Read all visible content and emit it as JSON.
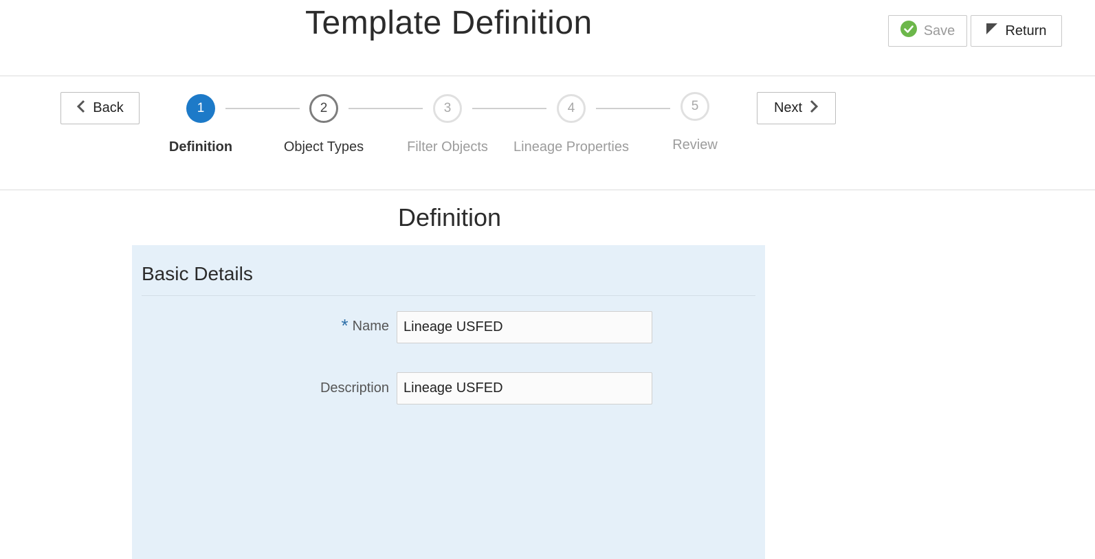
{
  "header": {
    "title": "Template Definition",
    "save_label": "Save",
    "return_label": "Return"
  },
  "train": {
    "back_label": "Back",
    "next_label": "Next",
    "steps": [
      {
        "number": "1",
        "label": "Definition",
        "state": "active"
      },
      {
        "number": "2",
        "label": "Object Types",
        "state": "visited"
      },
      {
        "number": "3",
        "label": "Filter Objects",
        "state": "disabled"
      },
      {
        "number": "4",
        "label": "Lineage Properties",
        "state": "disabled"
      },
      {
        "number": "5",
        "label": "Review",
        "state": "disabled"
      }
    ]
  },
  "main": {
    "section_title": "Definition",
    "panel_title": "Basic Details",
    "fields": {
      "name": {
        "label": "Name",
        "value": "Lineage USFED",
        "required": true,
        "required_mark": "*"
      },
      "description": {
        "label": "Description",
        "value": "Lineage USFED"
      }
    }
  },
  "colors": {
    "accent": "#1d7ac8",
    "panel_bg": "#e5f0f9",
    "save_check": "#6cb74a"
  }
}
